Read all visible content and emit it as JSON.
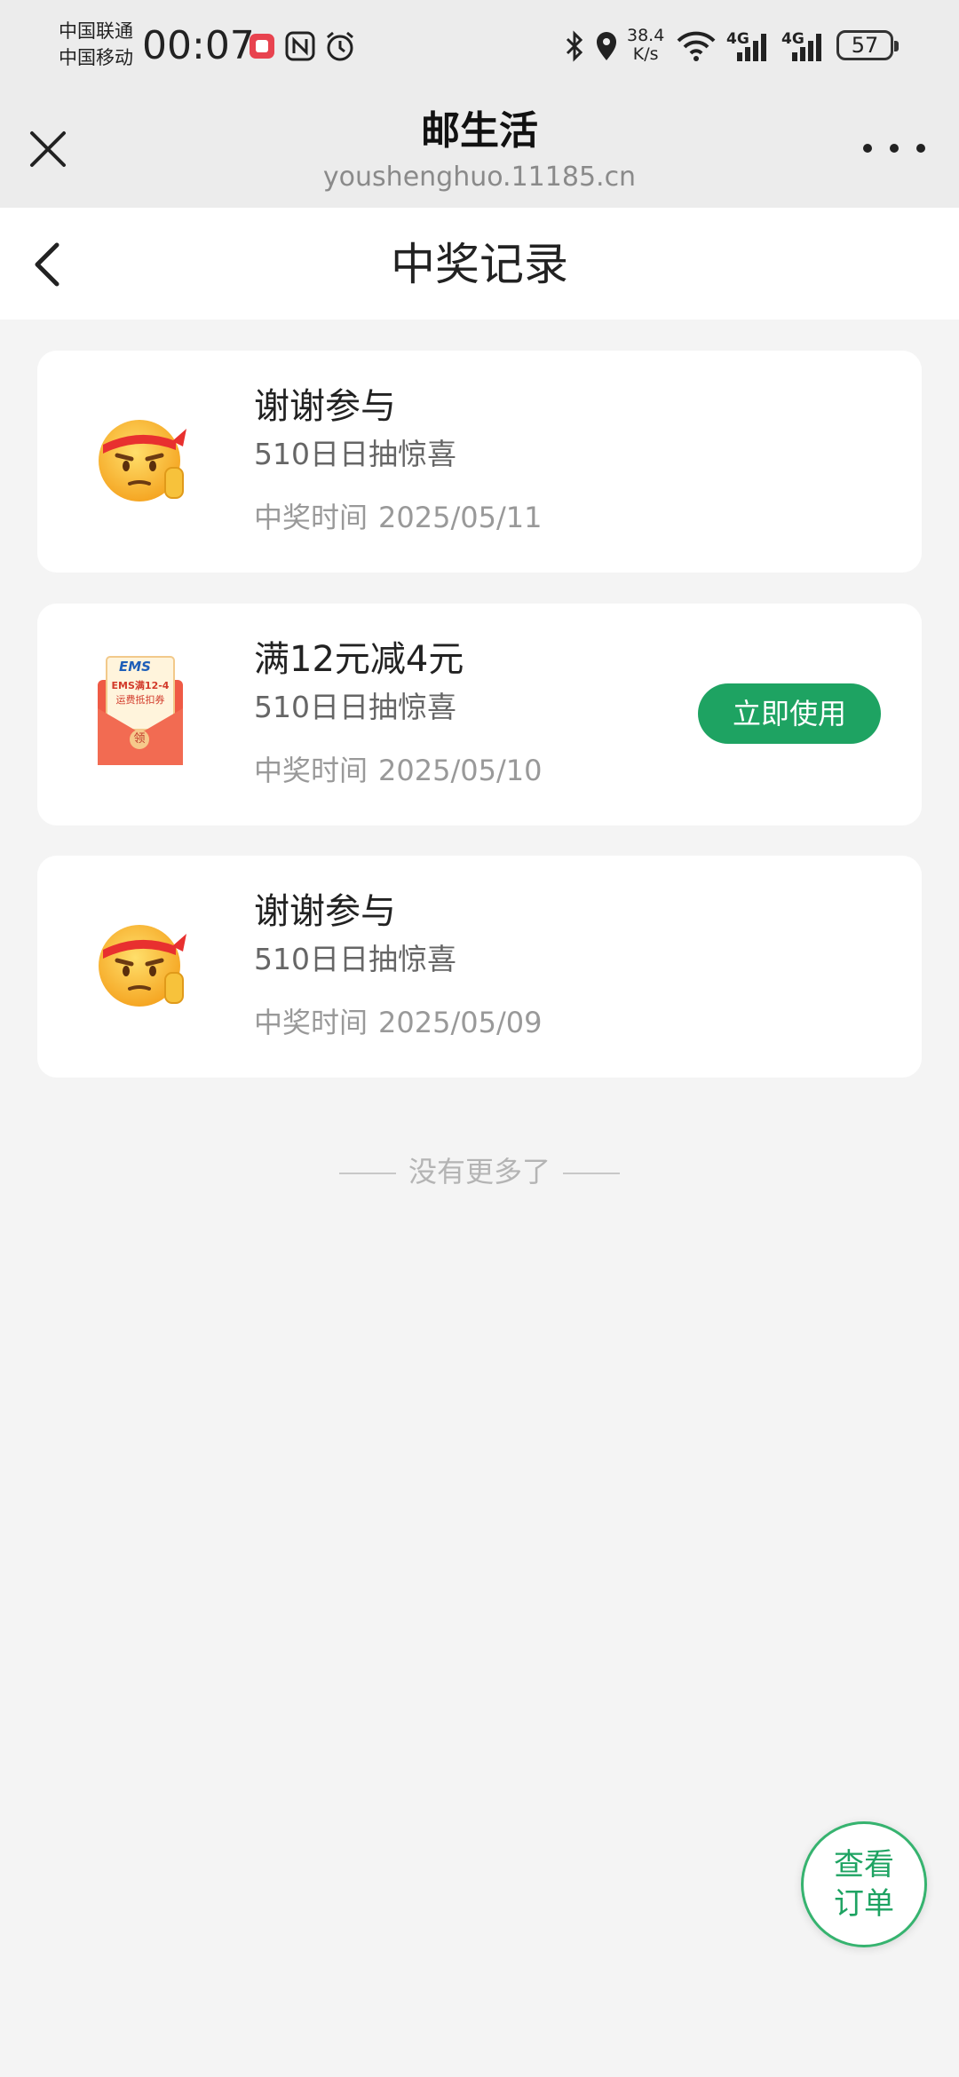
{
  "status_bar": {
    "carrier_1": "中国联通",
    "carrier_2": "中国移动",
    "time": "00:07",
    "net_speed_value": "38.4",
    "net_speed_unit": "K/s",
    "signal_1_label": "4G",
    "signal_2_label": "4G",
    "battery_level": "57",
    "icons": [
      "app-notification-icon",
      "nfc-icon",
      "alarm-icon",
      "bluetooth-icon",
      "location-icon",
      "wifi-icon",
      "signal-icon",
      "battery-icon"
    ]
  },
  "browser": {
    "title": "邮生活",
    "url": "youshenghuo.11185.cn"
  },
  "page": {
    "title": "中奖记录"
  },
  "records": [
    {
      "title": "谢谢参与",
      "subtitle": "510日日抽惊喜",
      "time_label": "中奖时间",
      "time": "2025/05/11",
      "image": "emoji-face-icon"
    },
    {
      "title": "满12元减4元",
      "subtitle": "510日日抽惊喜",
      "time_label": "中奖时间",
      "time": "2025/05/10",
      "image": "ems-coupon-envelope-icon",
      "action_label": "立即使用",
      "coupon_brand": "EMS",
      "coupon_text": "EMS满12-4",
      "coupon_subtext": "运费抵扣券",
      "coupon_seal": "领"
    },
    {
      "title": "谢谢参与",
      "subtitle": "510日日抽惊喜",
      "time_label": "中奖时间",
      "time": "2025/05/09",
      "image": "emoji-face-icon"
    }
  ],
  "end_text": "没有更多了",
  "fab": {
    "label": "查看订单"
  },
  "colors": {
    "accent_green": "#1ea362",
    "background": "#f4f4f4",
    "coupon_red": "#ef5a45"
  }
}
